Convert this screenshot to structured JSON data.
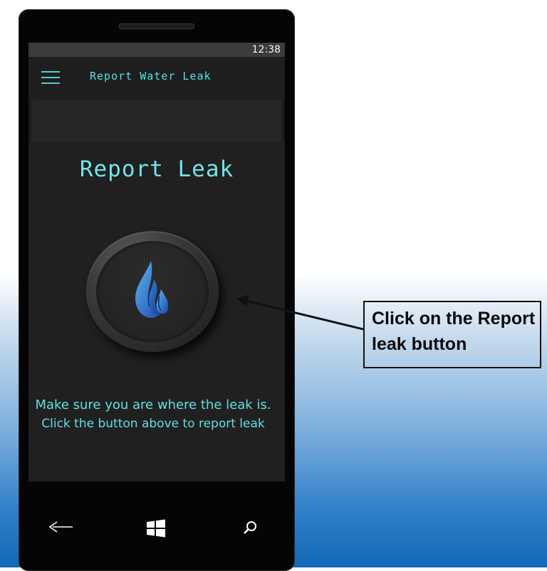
{
  "status_bar": {
    "time": "12:38"
  },
  "app_header": {
    "title": "Report Water Leak"
  },
  "main": {
    "page_title": "Report Leak",
    "instruction_line1": "Make sure you are where the leak is.",
    "instruction_line2": "Click the button above to report leak"
  },
  "icons": {
    "menu": "hamburger-menu-icon",
    "button": "water-drop-icon",
    "back": "back-arrow-icon",
    "home": "windows-logo-icon",
    "search": "search-icon"
  },
  "callout": {
    "text": "Click on the Report leak button"
  },
  "colors": {
    "accent": "#55e1e2",
    "screen_bg": "#202020",
    "phone_body": "#050505",
    "drop_light": "#4aa8f0",
    "drop_dark": "#1c4fb0"
  }
}
